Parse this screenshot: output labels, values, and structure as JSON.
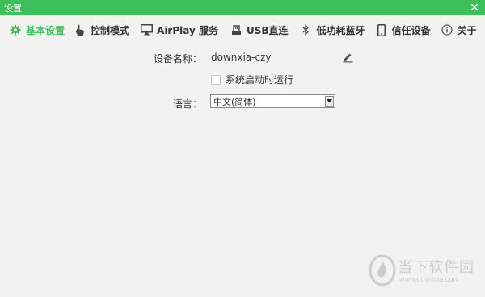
{
  "window": {
    "title": "设置",
    "close_glyph": "✕"
  },
  "tabs": [
    {
      "label": "基本设置",
      "icon": "gear-icon",
      "active": true
    },
    {
      "label": "控制模式",
      "icon": "hand-pointer-icon",
      "active": false
    },
    {
      "label": "AirPlay 服务",
      "icon": "airplay-icon",
      "active": false
    },
    {
      "label": "USB直连",
      "icon": "usb-icon",
      "active": false
    },
    {
      "label": "低功耗蓝牙",
      "icon": "bluetooth-icon",
      "active": false
    },
    {
      "label": "信任设备",
      "icon": "phone-icon",
      "active": false
    },
    {
      "label": "关于",
      "icon": "info-icon",
      "active": false
    }
  ],
  "settings": {
    "device_name_label": "设备名称：",
    "device_name_value": "downxia-czy",
    "autostart_label": "系统启动时运行",
    "autostart_checked": false,
    "language_label": "语言：",
    "language_value": "中文(简体)"
  },
  "watermark": {
    "name": "当下软件园",
    "url": "www.downxia.com"
  },
  "colors": {
    "accent": "#3fbf5b",
    "background": "#f2f2f2"
  }
}
